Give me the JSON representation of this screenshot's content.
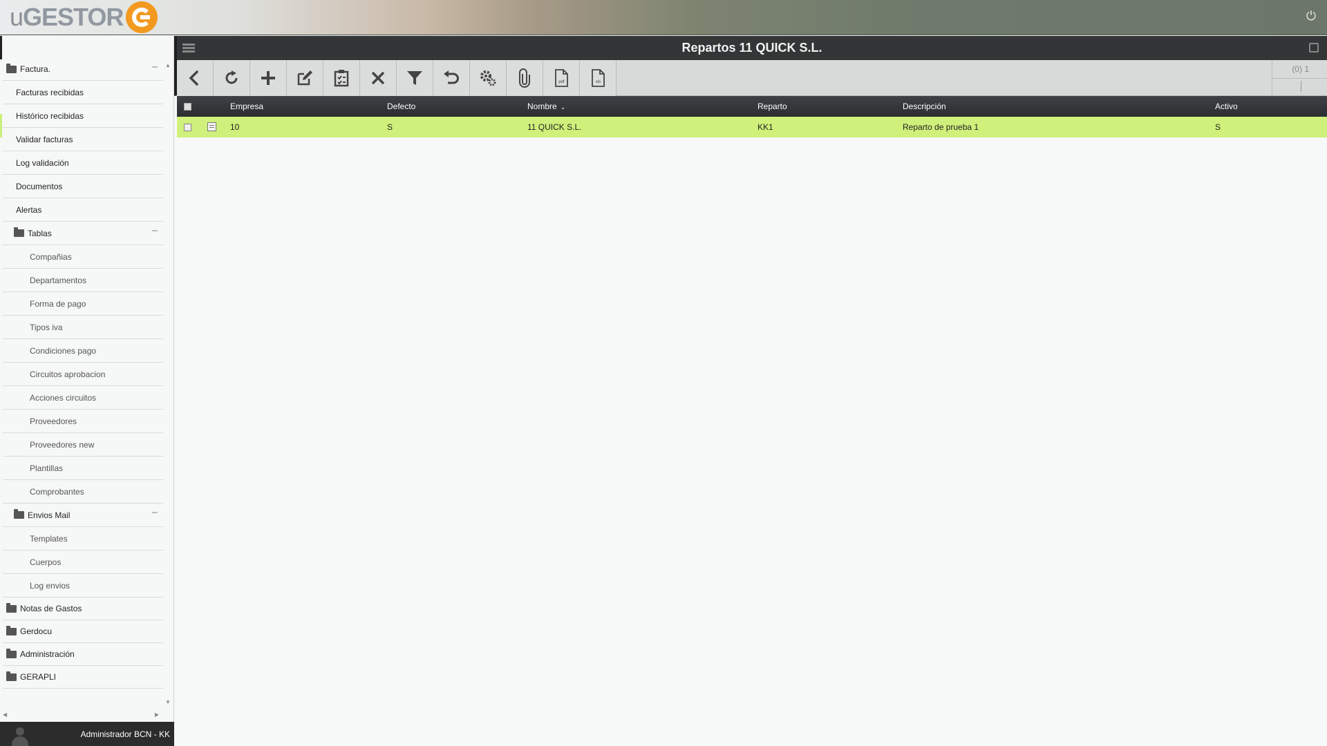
{
  "header": {
    "logo_prefix": "u",
    "logo_main": "GESTOR",
    "power_icon": "power-icon",
    "brand_color": "#f29a1f"
  },
  "sidebar": {
    "items": [
      {
        "label": "Factura.",
        "level": 0,
        "folder": true,
        "collapsible": true
      },
      {
        "label": "Facturas recibidas",
        "level": 1
      },
      {
        "label": "Histórico recibidas",
        "level": 1
      },
      {
        "label": "Validar facturas",
        "level": 1
      },
      {
        "label": "Log validación",
        "level": 1
      },
      {
        "label": "Documentos",
        "level": 1
      },
      {
        "label": "Alertas",
        "level": 1
      },
      {
        "label": "Tablas",
        "level": 1,
        "folder": true,
        "collapsible": true
      },
      {
        "label": "Compañias",
        "level": 2
      },
      {
        "label": "Departamentos",
        "level": 2
      },
      {
        "label": "Forma de pago",
        "level": 2
      },
      {
        "label": "Tipos iva",
        "level": 2
      },
      {
        "label": "Condiciones pago",
        "level": 2
      },
      {
        "label": "Circuitos aprobacion",
        "level": 2
      },
      {
        "label": "Acciones circuitos",
        "level": 2
      },
      {
        "label": "Proveedores",
        "level": 2
      },
      {
        "label": "Proveedores new",
        "level": 2
      },
      {
        "label": "Plantillas",
        "level": 2
      },
      {
        "label": "Comprobantes",
        "level": 2
      },
      {
        "label": "Envios Mail",
        "level": 1,
        "folder": true,
        "collapsible": true
      },
      {
        "label": "Templates",
        "level": 2
      },
      {
        "label": "Cuerpos",
        "level": 2
      },
      {
        "label": "Log envios",
        "level": 2
      },
      {
        "label": "Notas de Gastos",
        "level": 0,
        "folder": true
      },
      {
        "label": "Gerdocu",
        "level": 0,
        "folder": true
      },
      {
        "label": "Administración",
        "level": 0,
        "folder": true
      },
      {
        "label": "GERAPLI",
        "level": 0,
        "folder": true
      }
    ]
  },
  "user": {
    "name": "Administrador BCN - KK"
  },
  "titlebar": {
    "title": "Repartos 11 QUICK S.L."
  },
  "toolbar": {
    "buttons": [
      "back-icon",
      "refresh-icon",
      "add-icon",
      "edit-icon",
      "clipboard-icon",
      "delete-icon",
      "filter-icon",
      "undo-icon",
      "settings-icon",
      "attach-icon",
      "pdf-icon",
      "xls-icon"
    ],
    "pdf_label": "pdf",
    "xls_label": "xls",
    "counter": "(0) 1"
  },
  "grid": {
    "columns": [
      "Empresa",
      "Defecto",
      "Nombre",
      "Reparto",
      "Descripción",
      "Activo"
    ],
    "sort_indicator": "⌄",
    "rows": [
      {
        "empresa": "10",
        "defecto": "S",
        "nombre": "11 QUICK S.L.",
        "reparto": "KK1",
        "descripcion": "Reparto de prueba 1",
        "activo": "S"
      }
    ],
    "selected_row_color": "#cff07a"
  }
}
